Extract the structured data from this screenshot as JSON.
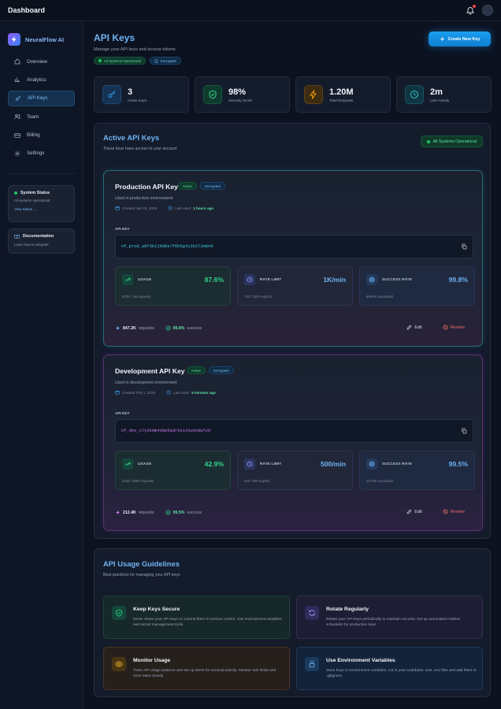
{
  "topbar": {
    "title": "Dashboard"
  },
  "brand": {
    "name": "NeuralFlow AI"
  },
  "nav": [
    {
      "label": "Overview",
      "icon": "home-icon"
    },
    {
      "label": "Analytics",
      "icon": "bar-chart-icon"
    },
    {
      "label": "API Keys",
      "icon": "key-icon",
      "active": true
    },
    {
      "label": "Team",
      "icon": "users-icon"
    },
    {
      "label": "Billing",
      "icon": "credit-card-icon"
    },
    {
      "label": "Settings",
      "icon": "gear-icon"
    }
  ],
  "system_status": {
    "title": "System Status",
    "text": "All systems operational",
    "link": "View Status →"
  },
  "docs": {
    "title": "Documentation",
    "text": "Learn how to integrate"
  },
  "header": {
    "title": "API Keys",
    "subtitle": "Manage your API keys and access tokens",
    "pill_status": "All Systems Operational",
    "pill_encrypted": "Encrypted",
    "create_button": "Create New Key"
  },
  "stats": [
    {
      "value": "3",
      "label": "Active Keys",
      "icon": "key-icon",
      "color": "#3aa0f0"
    },
    {
      "value": "98%",
      "label": "Security Score",
      "icon": "shield-check-icon",
      "color": "#2fd58a"
    },
    {
      "value": "1.20M",
      "label": "Total Requests",
      "icon": "lightning-icon",
      "color": "#f59e0b"
    },
    {
      "value": "2m",
      "label": "Last Activity",
      "icon": "clock-icon",
      "color": "#2fc8d8"
    }
  ],
  "active_keys": {
    "title": "Active API Keys",
    "subtitle": "These keys have access to your account",
    "status": "All Systems Operational"
  },
  "keys": [
    {
      "name": "Production API Key",
      "status": "Active",
      "encrypted": "Encrypted",
      "description": "Used in production environment",
      "created": "Created Jan 15, 2026",
      "last_used_label": "Last used",
      "last_used": "2 hours ago",
      "key_label": "API KEY",
      "key": "nf_prod_a8f3k2j9d8s7f6h5g4j3k2l1m0n9",
      "key_color": "#3fd1e6",
      "usage": {
        "label": "USAGE",
        "value": "87.6%",
        "sub": "872K / 1M requests",
        "fraction": 0.876
      },
      "rate": {
        "label": "RATE LIMIT",
        "value": "1K/min",
        "sub": "723 / 1000 req/min"
      },
      "success": {
        "label": "SUCCESS RATE",
        "value": "99.8%",
        "sub": "846.5K successful"
      },
      "requests": "847.2K",
      "requests_label": "requests",
      "success_pct": "99.8%",
      "success_label": "success",
      "edit": "Edit",
      "revoke": "Revoke"
    },
    {
      "name": "Development API Key",
      "status": "Active",
      "encrypted": "Encrypted",
      "description": "Used in development environment",
      "created": "Created Feb 1, 2026",
      "last_used_label": "Last used",
      "last_used": "5 minutes ago",
      "key_label": "API KEY",
      "key": "nf_dev_x7y2k9m4n8p5q3r6s1t0u9v8w7z6",
      "key_color": "#c77ee8",
      "usage": {
        "label": "USAGE",
        "value": "42.9%",
        "sub": "212K / 500K requests",
        "fraction": 0.429
      },
      "rate": {
        "label": "RATE LIMIT",
        "value": "500/min",
        "sub": "224 / 500 req/min"
      },
      "success": {
        "label": "SUCCESS RATE",
        "value": "99.5%",
        "sub": "210.9K successful"
      },
      "requests": "212.4K",
      "requests_label": "requests",
      "success_pct": "99.5%",
      "success_label": "success",
      "edit": "Edit",
      "revoke": "Revoke"
    }
  ],
  "guidelines": {
    "title": "API Usage Guidelines",
    "subtitle": "Best practices for managing your API keys",
    "items": [
      {
        "title": "Keep Keys Secure",
        "text": "Never share your API keys or commit them to version control. Use environment variables and secret management tools.",
        "icon": "shield-check-icon"
      },
      {
        "title": "Rotate Regularly",
        "text": "Rotate your API keys periodically to maintain security. Set up automated rotation schedules for production keys.",
        "icon": "refresh-icon"
      },
      {
        "title": "Monitor Usage",
        "text": "Track API usage patterns and set up alerts for unusual activity. Monitor rate limits and error rates closely.",
        "icon": "eye-icon"
      },
      {
        "title": "Use Environment Variables",
        "text": "Store keys in environment variables, not in your codebase. Use .env files and add them to .gitignore.",
        "icon": "lock-icon"
      }
    ]
  }
}
